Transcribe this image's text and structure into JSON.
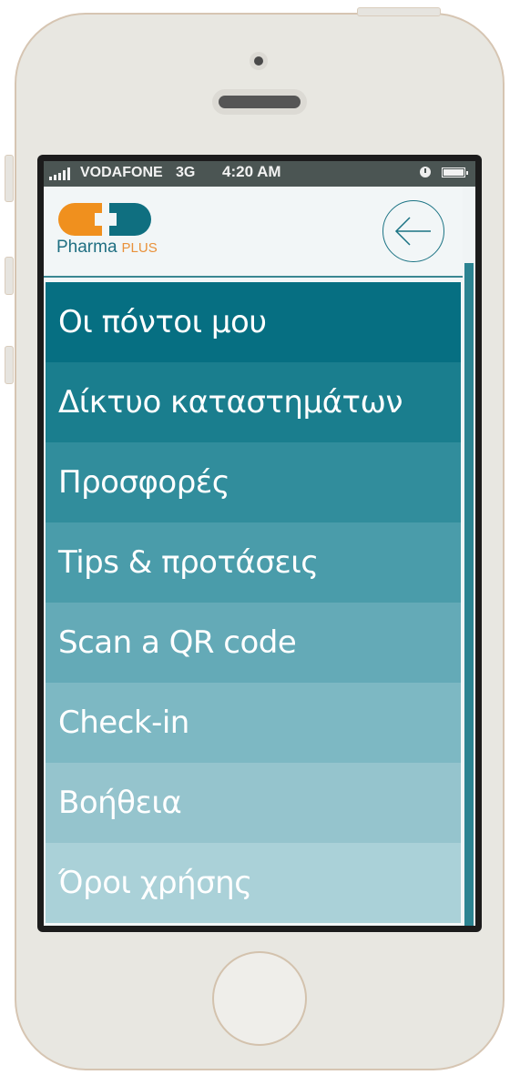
{
  "status_bar": {
    "carrier": "VODAFONE",
    "network": "3G",
    "time": "4:20 AM",
    "icons": [
      "signal-icon",
      "clock-icon",
      "battery-icon"
    ]
  },
  "header": {
    "logo": {
      "name": "Pharma",
      "suffix": "PLUS",
      "colors": {
        "orange": "#f0901e",
        "teal": "#0f6f80"
      }
    },
    "back_icon": "arrow-left-icon"
  },
  "menu": {
    "items": [
      {
        "label": "Οι πόντοι μου",
        "color": "#066f82"
      },
      {
        "label": "Δίκτυο καταστημάτων",
        "color": "#1a7e8e"
      },
      {
        "label": "Προσφορές",
        "color": "#318d9c"
      },
      {
        "label": "Tips & προτάσεις",
        "color": "#4a9caa"
      },
      {
        "label": "Scan a QR code",
        "color": "#64aab7"
      },
      {
        "label": "Check-in",
        "color": "#7db8c3"
      },
      {
        "label": "Βοήθεια",
        "color": "#95c4cd"
      },
      {
        "label": "Όροι χρήσης",
        "color": "#aad1d8"
      }
    ]
  }
}
